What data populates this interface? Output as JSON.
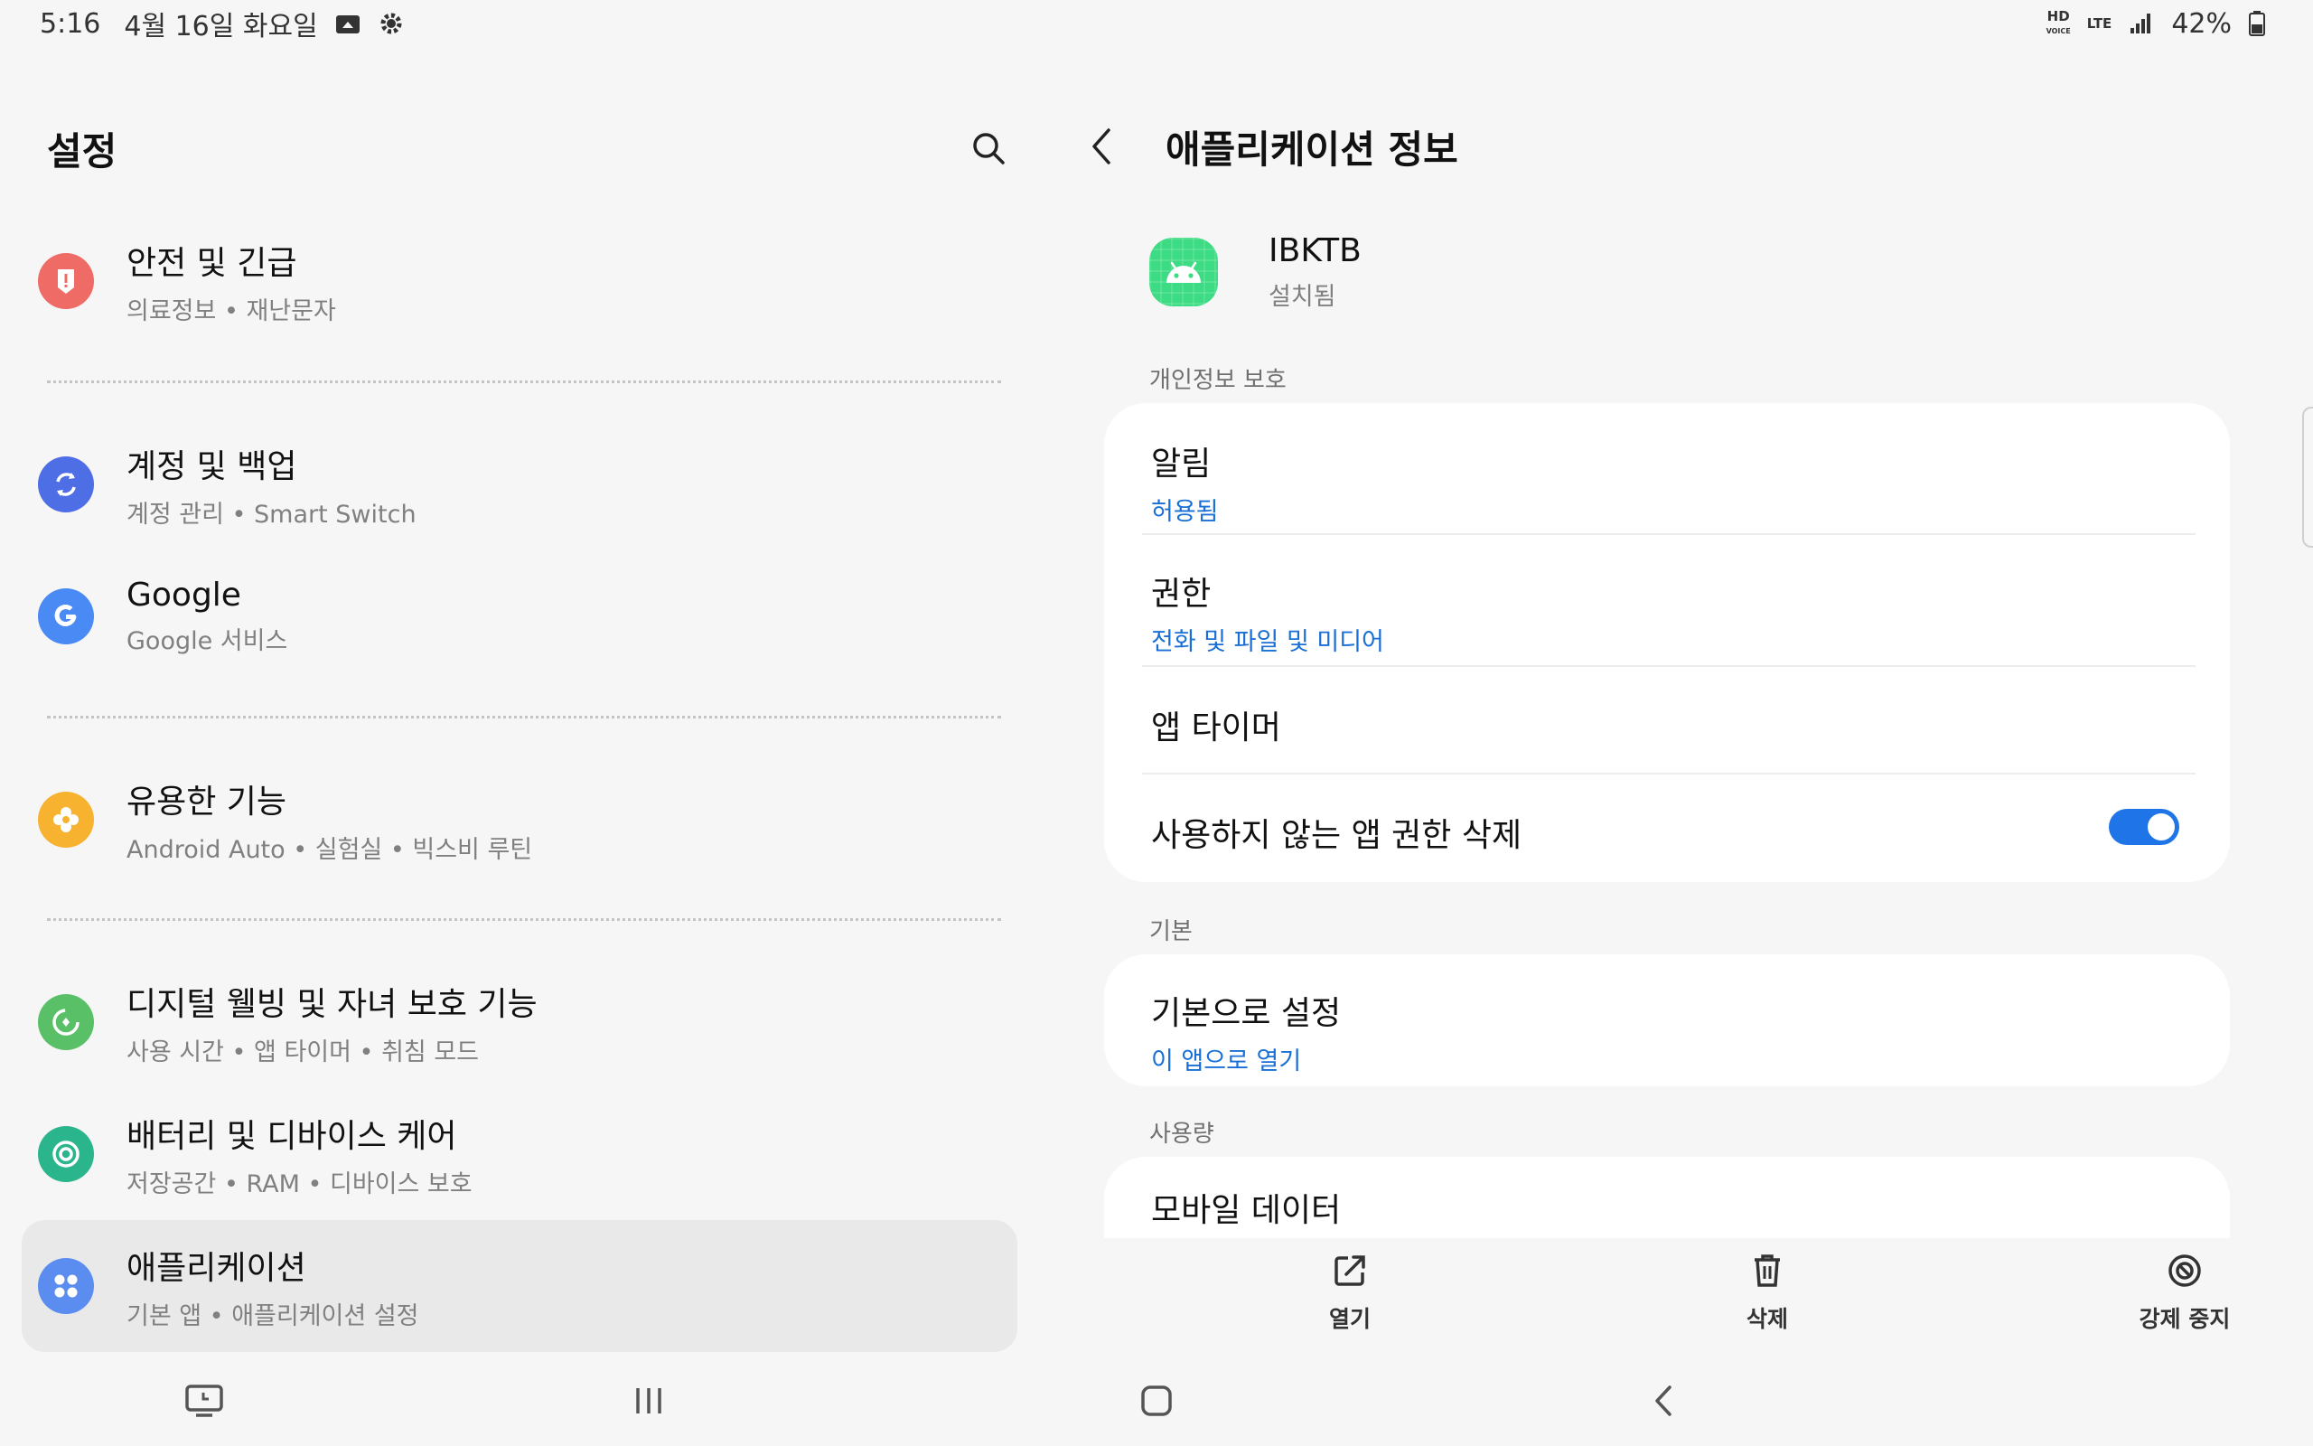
{
  "status_bar": {
    "time": "5:16",
    "date": "4월 16일 화요일",
    "network": "LTE",
    "hd_voice": "HD",
    "battery": "42%"
  },
  "settings": {
    "title": "설정",
    "items": [
      {
        "title": "안전 및 긴급",
        "subtitle": "의료정보 • 재난문자",
        "icon": "alert-icon",
        "color": "#ef6b66"
      },
      {
        "title": "계정 및 백업",
        "subtitle": "계정 관리 • Smart Switch",
        "icon": "sync-icon",
        "color": "#4e6ee6"
      },
      {
        "title": "Google",
        "subtitle": "Google 서비스",
        "icon": "google-icon",
        "color": "#4a8af4"
      },
      {
        "title": "유용한 기능",
        "subtitle": "Android Auto • 실험실 • 빅스비 루틴",
        "icon": "puzzle-icon",
        "color": "#f7b230"
      },
      {
        "title": "디지털 웰빙 및 자녀 보호 기능",
        "subtitle": "사용 시간 • 앱 타이머 • 취침 모드",
        "icon": "wellbeing-icon",
        "color": "#5ac067"
      },
      {
        "title": "배터리 및 디바이스 케어",
        "subtitle": "저장공간 • RAM • 디바이스 보호",
        "icon": "device-care-icon",
        "color": "#2bb58c"
      },
      {
        "title": "애플리케이션",
        "subtitle": "기본 앱 • 애플리케이션 설정",
        "icon": "apps-icon",
        "color": "#5b8df0"
      }
    ]
  },
  "app_info": {
    "title": "애플리케이션 정보",
    "app_name": "IBKTB",
    "app_status": "설치됨",
    "sections": {
      "privacy": "개인정보 보호",
      "default": "기본",
      "usage": "사용량"
    },
    "notifications": {
      "title": "알림",
      "value": "허용됨"
    },
    "permissions": {
      "title": "권한",
      "value": "전화 및 파일 및 미디어"
    },
    "app_timer": {
      "title": "앱 타이머"
    },
    "remove_permissions": {
      "title": "사용하지 않는 앱 권한 삭제",
      "enabled": true
    },
    "set_default": {
      "title": "기본으로 설정",
      "value": "이 앱으로 열기"
    },
    "mobile_data": {
      "title": "모바일 데이터"
    },
    "actions": {
      "open": "열기",
      "uninstall": "삭제",
      "force_stop": "강제 중지"
    }
  },
  "colors": {
    "accent_blue": "#1a6fd6",
    "toggle_on": "#1f75e8",
    "android_green": "#3ddc84"
  }
}
